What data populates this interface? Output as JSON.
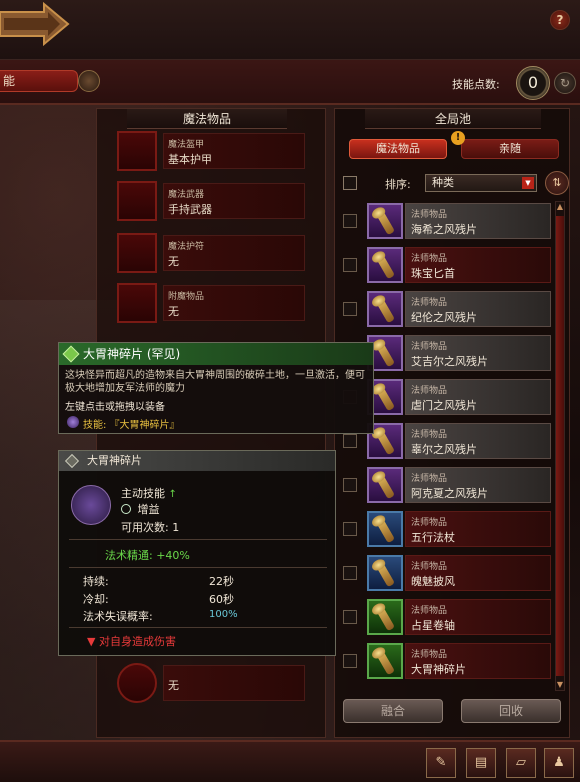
{
  "header": {
    "tab_title": "能",
    "skill_points_label": "技能点数:",
    "skill_points_value": "0",
    "help": "?"
  },
  "left_panel": {
    "title": "魔法物品",
    "slots": [
      {
        "type": "魔法盔甲",
        "value": "基本护甲"
      },
      {
        "type": "魔法武器",
        "value": "手持武器"
      },
      {
        "type": "魔法护符",
        "value": "无"
      },
      {
        "type": "附魔物品",
        "value": "无"
      }
    ],
    "bottom_slot_value": "无"
  },
  "right_panel": {
    "title": "全局池",
    "tabs": [
      "魔法物品",
      "亲随"
    ],
    "alert": "!",
    "sort_label": "排序:",
    "sort_value": "种类",
    "items": [
      {
        "category": "法师物品",
        "name": "海希之风残片",
        "color": "purple",
        "card": "grey"
      },
      {
        "category": "法师物品",
        "name": "珠宝匕首",
        "color": "purple",
        "card": "red"
      },
      {
        "category": "法师物品",
        "name": "纪伦之风残片",
        "color": "purple",
        "card": "grey"
      },
      {
        "category": "法师物品",
        "name": "艾吉尔之风残片",
        "color": "purple",
        "card": "grey"
      },
      {
        "category": "法师物品",
        "name": "虐门之风残片",
        "color": "purple",
        "card": "grey"
      },
      {
        "category": "法师物品",
        "name": "辜尔之风残片",
        "color": "purple",
        "card": "grey"
      },
      {
        "category": "法师物品",
        "name": "阿克夏之风残片",
        "color": "purple",
        "card": "grey"
      },
      {
        "category": "法师物品",
        "name": "五行法杖",
        "color": "blue",
        "card": "red"
      },
      {
        "category": "法师物品",
        "name": "魄魅披风",
        "color": "blue",
        "card": "red"
      },
      {
        "category": "法师物品",
        "name": "占星卷轴",
        "color": "green",
        "card": "red"
      },
      {
        "category": "法师物品",
        "name": "大胃神碎片",
        "color": "green",
        "card": "red"
      }
    ],
    "merge_button": "融合",
    "recycle_button": "回收"
  },
  "tooltip_item": {
    "title": "大胃神碎片 (罕见)",
    "description": "这块怪异而超凡的造物来自大胃神周围的破碎土地，一旦激活，便可极大地增加友军法师的魔力",
    "hint": "左键点击或拖拽以装备",
    "skill": "技能: 『大胃神碎片』"
  },
  "tooltip_skill": {
    "title": "大胃神碎片",
    "skill_type": "主动技能",
    "tag": "增益",
    "uses": "可用次数: 1",
    "mastery": "法术精通: +40%",
    "stats": [
      {
        "label": "持续:",
        "value": "22秒"
      },
      {
        "label": "冷却:",
        "value": "60秒"
      },
      {
        "label": "法术失误概率:",
        "value": "100%"
      }
    ],
    "warning": "对自身造成伤害"
  }
}
